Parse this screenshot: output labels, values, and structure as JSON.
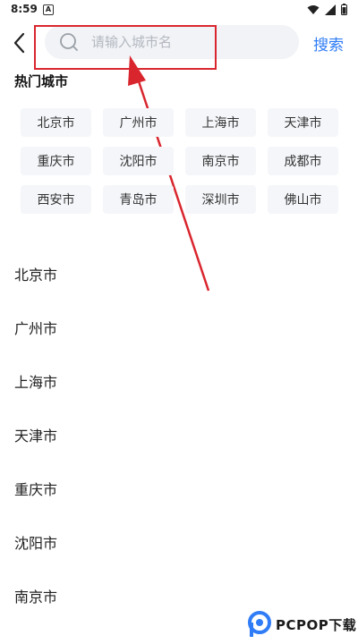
{
  "status": {
    "time": "8:59",
    "notif_icon": "A"
  },
  "header": {
    "search_placeholder": "请输入城市名",
    "search_label": "搜索"
  },
  "hot": {
    "title": "热门城市",
    "cities": [
      "北京市",
      "广州市",
      "上海市",
      "天津市",
      "重庆市",
      "沈阳市",
      "南京市",
      "成都市",
      "西安市",
      "青岛市",
      "深圳市",
      "佛山市"
    ]
  },
  "list": {
    "cities": [
      "北京市",
      "广州市",
      "上海市",
      "天津市",
      "重庆市",
      "沈阳市",
      "南京市"
    ]
  },
  "watermark": {
    "text": "PCPOP下载"
  },
  "colors": {
    "accent": "#2f7cf6",
    "annotation": "#d9262e",
    "chip_bg": "#f4f6f9",
    "search_bg": "#f1f3f6"
  }
}
